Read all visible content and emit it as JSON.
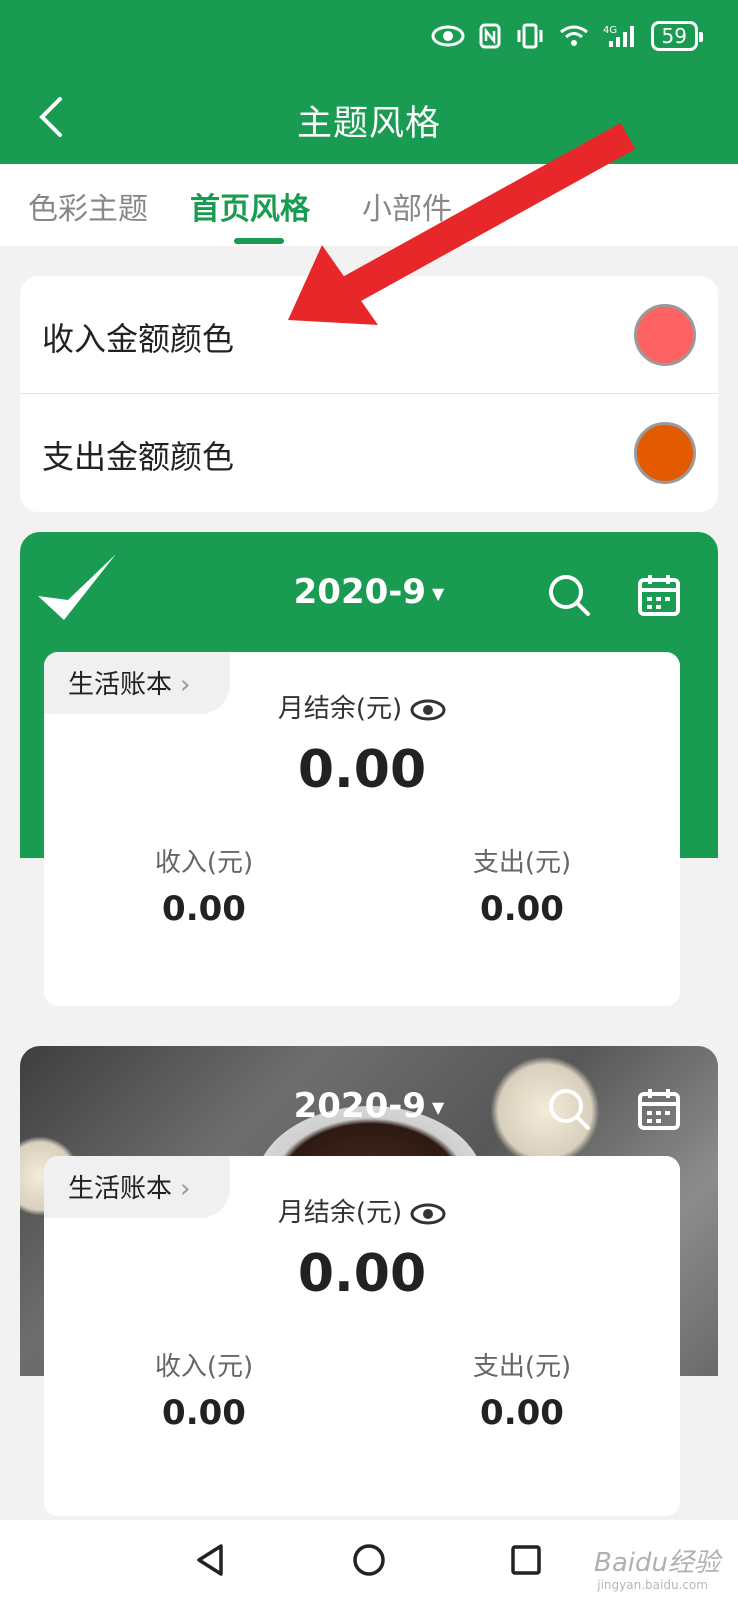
{
  "status_bar": {
    "battery": "59",
    "signal": "4G"
  },
  "header": {
    "title": "主题风格"
  },
  "tabs": [
    {
      "label": "色彩主题",
      "active": false
    },
    {
      "label": "首页风格",
      "active": true
    },
    {
      "label": "小部件",
      "active": false
    }
  ],
  "color_settings": {
    "income": {
      "label": "收入金额颜色",
      "color": "#ff6262"
    },
    "expense": {
      "label": "支出金额颜色",
      "color": "#e45a00"
    }
  },
  "preview_green": {
    "month": "2020-9",
    "book": "生活账本",
    "balance_label": "月结余(元)",
    "balance_value": "0.00",
    "income_label": "收入(元)",
    "income_value": "0.00",
    "expense_label": "支出(元)",
    "expense_value": "0.00"
  },
  "preview_photo": {
    "month": "2020-9",
    "book": "生活账本",
    "balance_label": "月结余(元)",
    "balance_value": "0.00",
    "income_label": "收入(元)",
    "income_value": "0.00",
    "expense_label": "支出(元)",
    "expense_value": "0.00"
  },
  "watermark": {
    "text": "Baidu经验",
    "sub": "jingyan.baidu.com"
  },
  "colors": {
    "primary": "#1a9b52",
    "arrow": "#e8272a"
  }
}
